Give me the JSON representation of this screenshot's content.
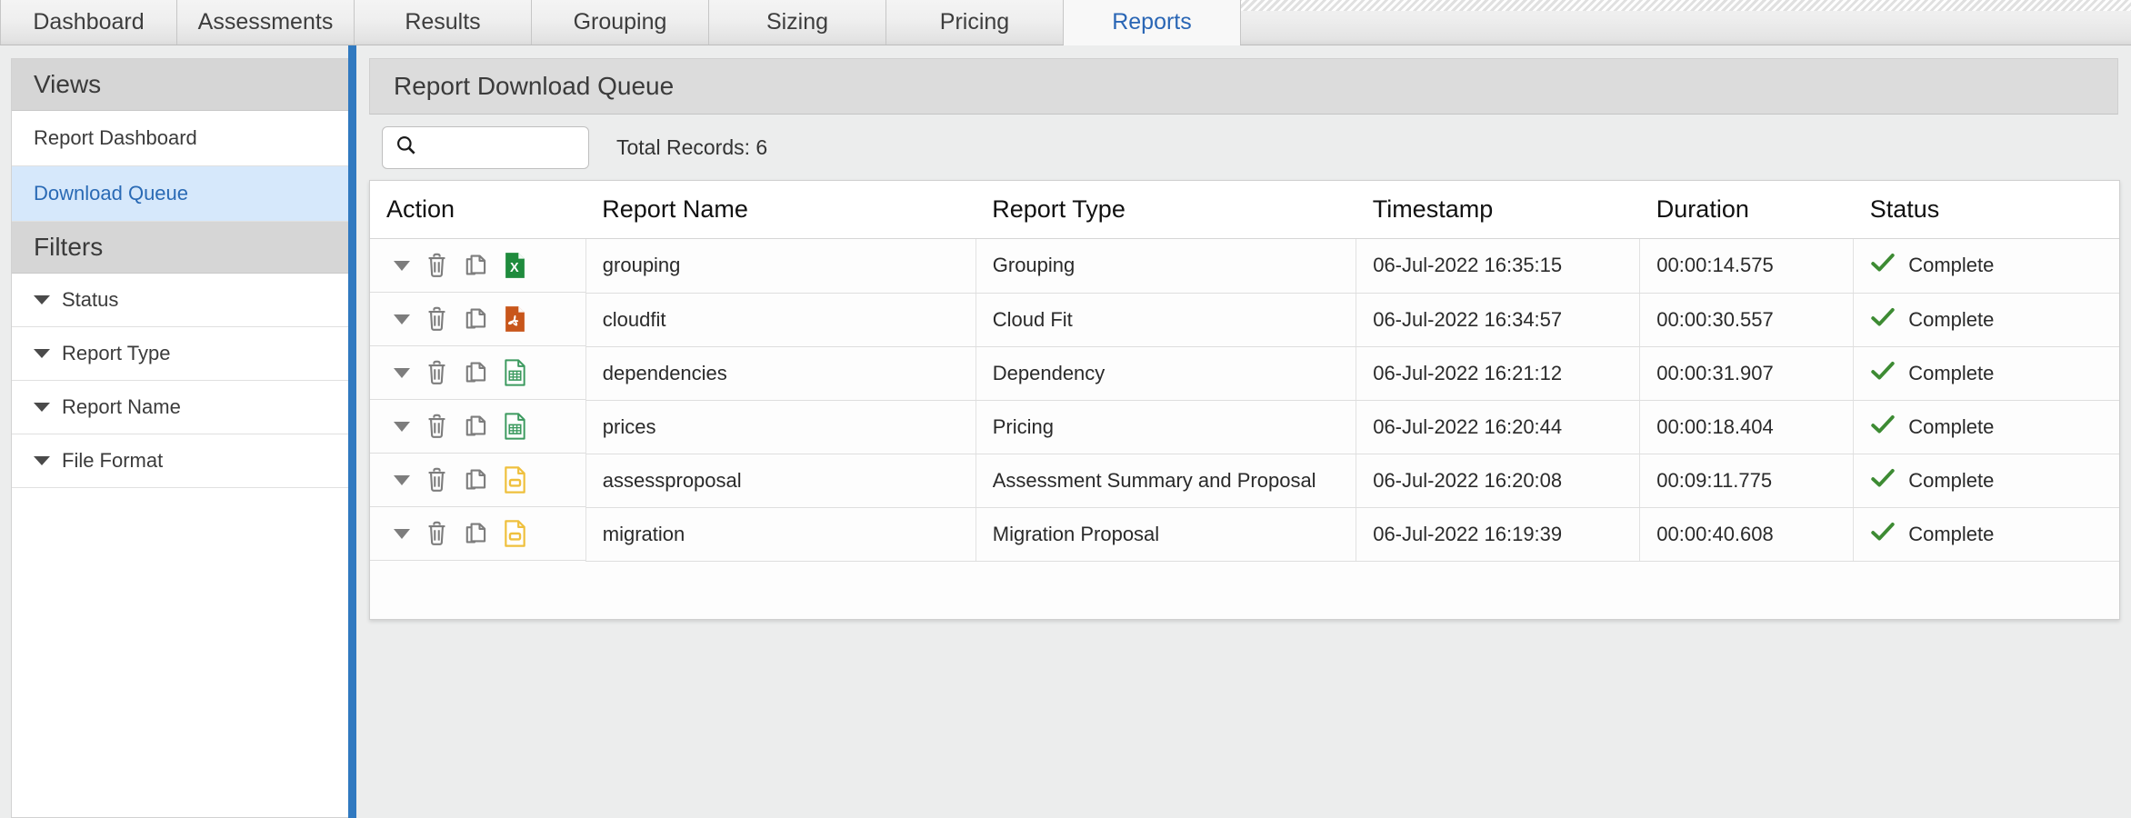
{
  "tabs": [
    {
      "label": "Dashboard",
      "active": false
    },
    {
      "label": "Assessments",
      "active": false
    },
    {
      "label": "Results",
      "active": false
    },
    {
      "label": "Grouping",
      "active": false
    },
    {
      "label": "Sizing",
      "active": false
    },
    {
      "label": "Pricing",
      "active": false
    },
    {
      "label": "Reports",
      "active": true
    }
  ],
  "sidebar": {
    "views_header": "Views",
    "views": [
      {
        "label": "Report Dashboard",
        "selected": false
      },
      {
        "label": "Download Queue",
        "selected": true
      }
    ],
    "filters_header": "Filters",
    "filters": [
      {
        "label": "Status"
      },
      {
        "label": "Report Type"
      },
      {
        "label": "Report Name"
      },
      {
        "label": "File Format"
      }
    ]
  },
  "main": {
    "panel_title": "Report Download Queue",
    "search": {
      "value": "",
      "placeholder": ""
    },
    "total_records_label": "Total Records: 6",
    "columns": [
      "Action",
      "Report Name",
      "Report Type",
      "Timestamp",
      "Duration",
      "Status"
    ],
    "rows": [
      {
        "report_name": "grouping",
        "report_type": "Grouping",
        "timestamp": "06-Jul-2022 16:35:15",
        "duration": "00:00:14.575",
        "status": "Complete",
        "file_format_icon": "excel-file-icon"
      },
      {
        "report_name": "cloudfit",
        "report_type": "Cloud Fit",
        "timestamp": "06-Jul-2022 16:34:57",
        "duration": "00:00:30.557",
        "status": "Complete",
        "file_format_icon": "pdf-file-icon"
      },
      {
        "report_name": "dependencies",
        "report_type": "Dependency",
        "timestamp": "06-Jul-2022 16:21:12",
        "duration": "00:00:31.907",
        "status": "Complete",
        "file_format_icon": "csv-file-icon"
      },
      {
        "report_name": "prices",
        "report_type": "Pricing",
        "timestamp": "06-Jul-2022 16:20:44",
        "duration": "00:00:18.404",
        "status": "Complete",
        "file_format_icon": "csv-file-icon"
      },
      {
        "report_name": "assessproposal",
        "report_type": "Assessment Summary and Proposal",
        "timestamp": "06-Jul-2022 16:20:08",
        "duration": "00:09:11.775",
        "status": "Complete",
        "file_format_icon": "ppt-file-icon"
      },
      {
        "report_name": "migration",
        "report_type": "Migration Proposal",
        "timestamp": "06-Jul-2022 16:19:39",
        "duration": "00:00:40.608",
        "status": "Complete",
        "file_format_icon": "ppt-file-icon"
      }
    ]
  },
  "colors": {
    "active_tab_text": "#2a66b5",
    "selected_nav_bg": "#d6e8fb",
    "selected_nav_text": "#2a6ab5",
    "divider_blue": "#3079c0",
    "status_green": "#3d8b33",
    "excel_green": "#1f8b3d",
    "pdf_orange": "#c8561b",
    "csv_green": "#3c9a5f",
    "ppt_yellow": "#efc03d",
    "icon_gray": "#7d7d7d"
  }
}
